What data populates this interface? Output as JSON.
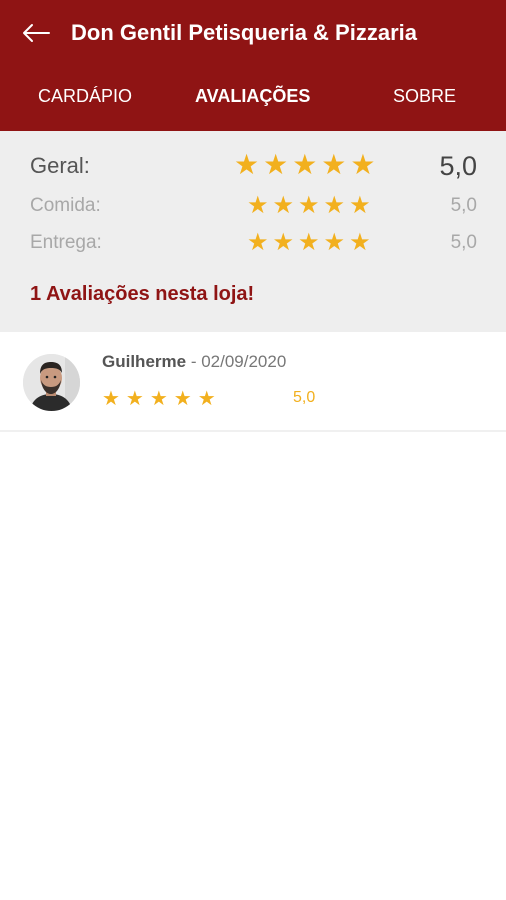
{
  "header": {
    "title": "Don Gentil Petisqueria & Pizzaria",
    "background_color": "#8f1414",
    "back_icon": "arrow-left-icon"
  },
  "tabs": [
    {
      "label": "CARDÁPIO",
      "active": false
    },
    {
      "label": "AVALIAÇÕES",
      "active": true
    },
    {
      "label": "SOBRE",
      "active": false
    }
  ],
  "summary": {
    "rows": [
      {
        "label": "Geral:",
        "stars": "★★★★★",
        "value": "5,0",
        "rating": 5
      },
      {
        "label": "Comida:",
        "stars": "★★★★★",
        "value": "5,0",
        "rating": 5
      },
      {
        "label": "Entrega:",
        "stars": "★★★★★",
        "value": "5,0",
        "rating": 5
      }
    ],
    "count_text": "1 Avaliações nesta loja!",
    "star_color": "#f2b01e"
  },
  "reviews": [
    {
      "name": "Guilherme",
      "separator": " - ",
      "date": "02/09/2020",
      "stars": "★★★★★",
      "value": "5,0",
      "rating": 5
    }
  ]
}
